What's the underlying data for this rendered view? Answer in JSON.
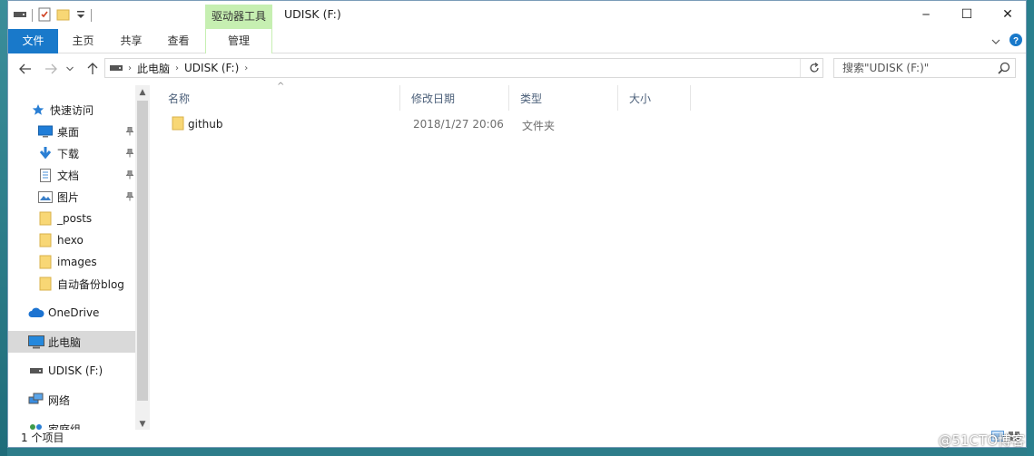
{
  "titlebar": {
    "title": "UDISK (F:)",
    "context_tab": "驱动器工具",
    "minimize_glyph": "─",
    "maximize_glyph": "☐",
    "close_glyph": "✕"
  },
  "ribbon": {
    "tabs": [
      {
        "label": "文件"
      },
      {
        "label": "主页"
      },
      {
        "label": "共享"
      },
      {
        "label": "查看"
      },
      {
        "label": "管理"
      }
    ]
  },
  "address": {
    "crumbs": [
      "此电脑",
      "UDISK (F:)"
    ],
    "search_placeholder": "搜索\"UDISK (F:)\""
  },
  "nav": {
    "items": [
      {
        "label": "快速访问",
        "icon": "star-icon"
      },
      {
        "label": "桌面",
        "icon": "desktop-icon",
        "pinned": true
      },
      {
        "label": "下载",
        "icon": "download-icon",
        "pinned": true
      },
      {
        "label": "文档",
        "icon": "document-icon",
        "pinned": true
      },
      {
        "label": "图片",
        "icon": "pictures-icon",
        "pinned": true
      },
      {
        "label": "_posts",
        "icon": "folder-icon"
      },
      {
        "label": "hexo",
        "icon": "folder-icon"
      },
      {
        "label": "images",
        "icon": "folder-icon"
      },
      {
        "label": "自动备份blog",
        "icon": "folder-icon"
      },
      {
        "label": "OneDrive",
        "icon": "cloud-icon"
      },
      {
        "label": "此电脑",
        "icon": "computer-icon"
      },
      {
        "label": "UDISK (F:)",
        "icon": "drive-icon"
      },
      {
        "label": "网络",
        "icon": "network-icon"
      },
      {
        "label": "家庭组",
        "icon": "homegroup-icon"
      }
    ]
  },
  "columns": {
    "name": "名称",
    "date": "修改日期",
    "type": "类型",
    "size": "大小"
  },
  "files": [
    {
      "name": "github",
      "date": "2018/1/27 20:06",
      "type": "文件夹",
      "size": ""
    }
  ],
  "status": {
    "count": "1 个项目"
  },
  "watermark": "@51CTO博客",
  "colors": {
    "file_tab": "#1979ca",
    "context_tab": "#c6efb1",
    "folder": "#f8d775",
    "selection": "#d9d9d9"
  }
}
